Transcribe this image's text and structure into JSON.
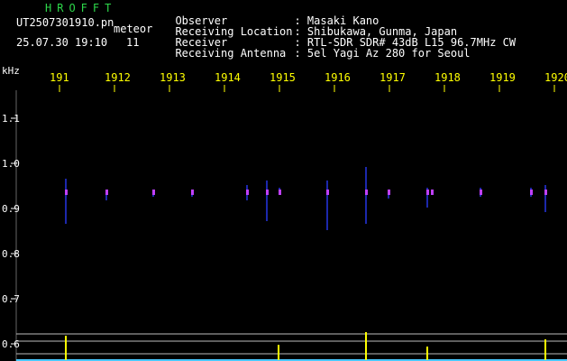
{
  "header": {
    "app_title": "HROFFT",
    "file_name": "UT2507301910.pn",
    "meteor_label": "meteor",
    "datetime": "25.07.30 19:10",
    "count": "11"
  },
  "info": [
    {
      "key": "Observer",
      "value": ": Masaki Kano"
    },
    {
      "key": "Receiving Location",
      "value": ": Shibukawa, Gunma, Japan"
    },
    {
      "key": "Receiver",
      "value": ": RTL-SDR SDR# 43dB L15 96.7MHz CW"
    },
    {
      "key": "Receiving Antenna",
      "value": ": 5el Yagi Az 280 for Seoul"
    }
  ],
  "axis": {
    "unit": "kHz",
    "y_ticks": [
      "1.1",
      "1.0",
      "0.9",
      "0.8",
      "0.7",
      "0.6"
    ],
    "x_ticks": [
      "191",
      "1912",
      "1913",
      "1914",
      "1915",
      "1916",
      "1917",
      "1918",
      "1919",
      "1920"
    ]
  },
  "colors": {
    "title": "#2dd84a",
    "time_labels": "#ffff00",
    "grid": "#ffffff",
    "signal": "#2a3cff"
  }
}
